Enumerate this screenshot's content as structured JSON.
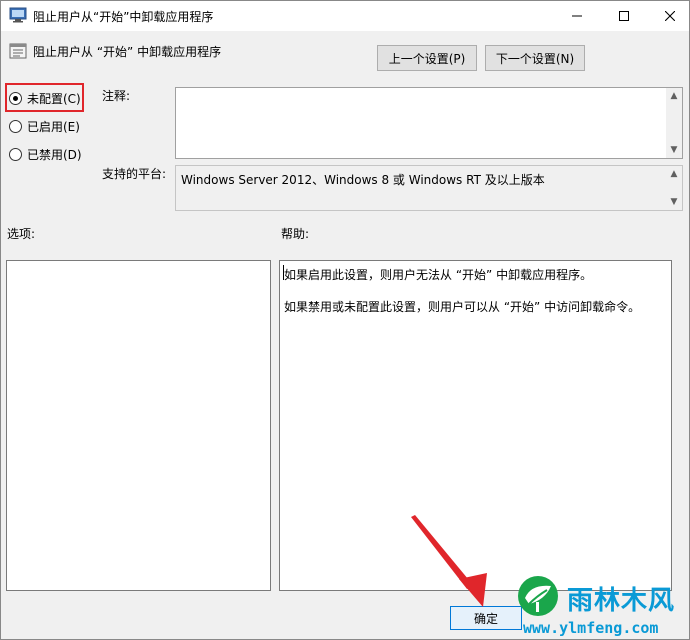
{
  "window": {
    "title": "阻止用户从“开始”中卸载应用程序",
    "setting_title": "阻止用户从 “开始” 中卸载应用程序"
  },
  "nav": {
    "prev_label": "上一个设置(P)",
    "next_label": "下一个设置(N)"
  },
  "state": {
    "options": [
      {
        "label": "未配置(C)",
        "selected": true
      },
      {
        "label": "已启用(E)",
        "selected": false
      },
      {
        "label": "已禁用(D)",
        "selected": false
      }
    ]
  },
  "fields": {
    "comment_label": "注释:",
    "comment_value": "",
    "platform_label": "支持的平台:",
    "platform_value": "Windows Server 2012、Windows 8 或 Windows RT 及以上版本"
  },
  "panes": {
    "options_label": "选项:",
    "help_label": "帮助:",
    "help_paragraphs": [
      "如果启用此设置，则用户无法从 “开始” 中卸载应用程序。",
      "如果禁用或未配置此设置，则用户可以从 “开始” 中访问卸载命令。"
    ]
  },
  "footer": {
    "ok_label": "确定"
  },
  "watermark": {
    "name": "雨林木风",
    "url": "www.ylmfeng.com"
  },
  "colors": {
    "highlight": "#e0262b",
    "accent": "#0078d7",
    "watermark": "#0a9ad6"
  },
  "icons": {
    "title": "policy-monitor-icon",
    "setting": "policy-settings-icon"
  }
}
